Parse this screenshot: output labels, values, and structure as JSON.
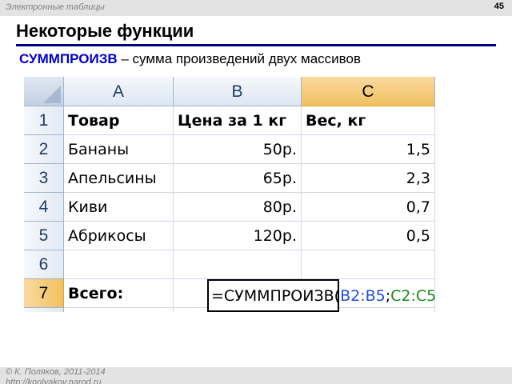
{
  "header": {
    "section_title": "Электронные таблицы",
    "page_number": "45"
  },
  "slide": {
    "title": "Некоторые функции",
    "subtitle_function": "СУММПРОИЗВ",
    "subtitle_rest": " – сумма произведений двух массивов"
  },
  "sheet": {
    "columns": [
      "A",
      "B",
      "C"
    ],
    "rows": [
      "1",
      "2",
      "3",
      "4",
      "5",
      "6",
      "7"
    ],
    "cells": {
      "A1": "Товар",
      "B1": "Цена за 1 кг",
      "C1": "Вес, кг",
      "A2": "Бананы",
      "B2": "50р.",
      "C2": "1,5",
      "A3": "Апельсины",
      "B3": "65р.",
      "C3": "2,3",
      "A4": "Киви",
      "B4": "80р.",
      "C4": "0,7",
      "A5": "Абрикосы",
      "B5": "120р.",
      "C5": "0,5",
      "A7": "Всего:"
    },
    "formula": {
      "prefix": "=СУММПРОИЗВ(",
      "range1": "B2:B5",
      "separator": ";",
      "range2": "C2:C5",
      "suffix": ")",
      "overflow": "5"
    },
    "colors": {
      "selected_header": "#f1c15f",
      "range1": "#1f4fd8",
      "range2": "#1a8a1a"
    }
  },
  "footer": {
    "author": "© К. Поляков, 2011-2014",
    "url": "http://kpolyakov.narod.ru"
  }
}
